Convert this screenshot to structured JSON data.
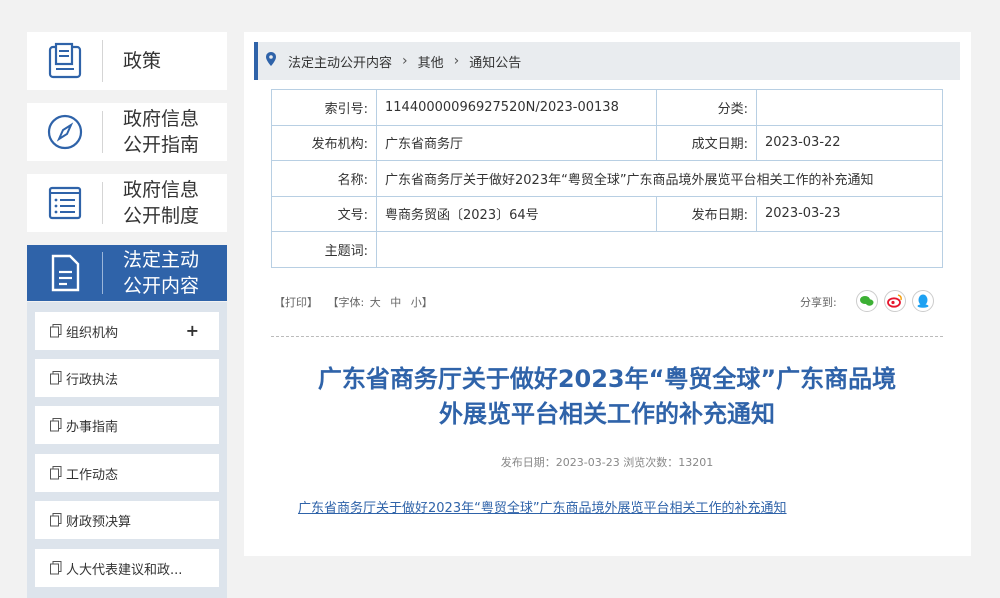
{
  "sidebar": {
    "cards": [
      {
        "label": "政策",
        "icon": "book-icon"
      },
      {
        "label": "政府信息\n公开指南",
        "icon": "compass-icon"
      },
      {
        "label": "政府信息\n公开制度",
        "icon": "list-document-icon"
      },
      {
        "label": "法定主动\n公开内容",
        "icon": "document-icon",
        "active": true
      }
    ],
    "sub_items": [
      {
        "label": "组织机构",
        "expand": "+"
      },
      {
        "label": "行政执法"
      },
      {
        "label": "办事指南"
      },
      {
        "label": "工作动态"
      },
      {
        "label": "财政预决算"
      },
      {
        "label": "人大代表建议和政..."
      }
    ]
  },
  "breadcrumb": {
    "items": [
      "法定主动公开内容",
      "其他",
      "通知公告"
    ],
    "separator": "›"
  },
  "meta": {
    "index_label": "索引号:",
    "index_value": "11440000096927520N/2023-00138",
    "category_label": "分类:",
    "category_value": "",
    "publisher_label": "发布机构:",
    "publisher_value": "广东省商务厅",
    "created_label": "成文日期:",
    "created_value": "2023-03-22",
    "name_label": "名称:",
    "name_value": "广东省商务厅关于做好2023年“粤贸全球”广东商品境外展览平台相关工作的补充通知",
    "docno_label": "文号:",
    "docno_value": "粤商务贸函〔2023〕64号",
    "pubdate_label": "发布日期:",
    "pubdate_value": "2023-03-23",
    "keywords_label": "主题词:",
    "keywords_value": ""
  },
  "tools": {
    "print": "【打印】",
    "font_label": "【字体:",
    "font_large": "大",
    "font_medium": "中",
    "font_small": "小】",
    "share_label": "分享到:"
  },
  "share_icons": [
    "wechat-icon",
    "weibo-icon",
    "qq-icon"
  ],
  "colors": {
    "accent": "#2f63a9",
    "wechat": "#3cb034",
    "weibo": "#e6162d",
    "qq": "#1da1f2"
  },
  "article": {
    "title_line1": "广东省商务厅关于做好2023年“粤贸全球”广东商品境",
    "title_line2": "外展览平台相关工作的补充通知",
    "pub_info": "发布日期：2023-03-23  浏览次数：13201",
    "attachment": "广东省商务厅关于做好2023年“粤贸全球”广东商品境外展览平台相关工作的补充通知"
  }
}
